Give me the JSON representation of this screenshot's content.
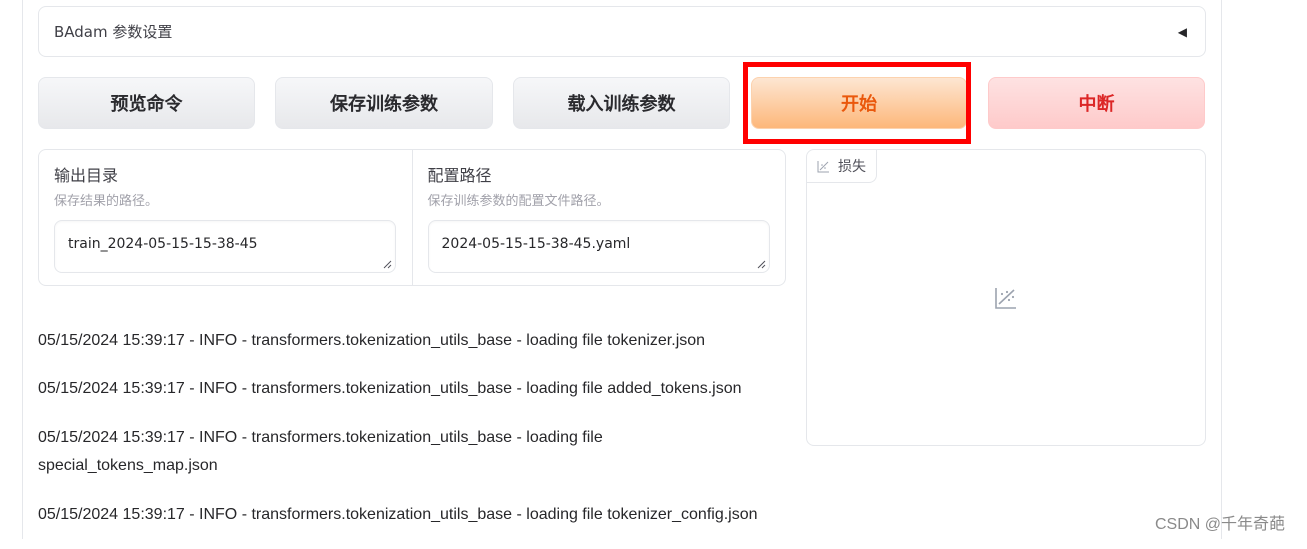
{
  "accordion": {
    "title": "BAdam 参数设置",
    "caret": "◀"
  },
  "buttons": {
    "preview": "预览命令",
    "save": "保存训练参数",
    "load": "载入训练参数",
    "start": "开始",
    "abort": "中断"
  },
  "settings": {
    "output_dir": {
      "label": "输出目录",
      "info": "保存结果的路径。",
      "value": "train_2024-05-15-15-38-45"
    },
    "config_path": {
      "label": "配置路径",
      "info": "保存训练参数的配置文件路径。",
      "value": "2024-05-15-15-38-45.yaml"
    }
  },
  "plot": {
    "label": "损失"
  },
  "log": {
    "lines": [
      "05/15/2024 15:39:17 - INFO - transformers.tokenization_utils_base - loading file tokenizer.json",
      "05/15/2024 15:39:17 - INFO - transformers.tokenization_utils_base - loading file added_tokens.json",
      "05/15/2024 15:39:17 - INFO - transformers.tokenization_utils_base - loading file special_tokens_map.json",
      "05/15/2024 15:39:17 - INFO - transformers.tokenization_utils_base - loading file tokenizer_config.json"
    ]
  },
  "watermark": "CSDN @千年奇葩",
  "colors": {
    "primary_text": "#ea580c",
    "stop_text": "#dc2626",
    "highlight": "#ff0000"
  }
}
